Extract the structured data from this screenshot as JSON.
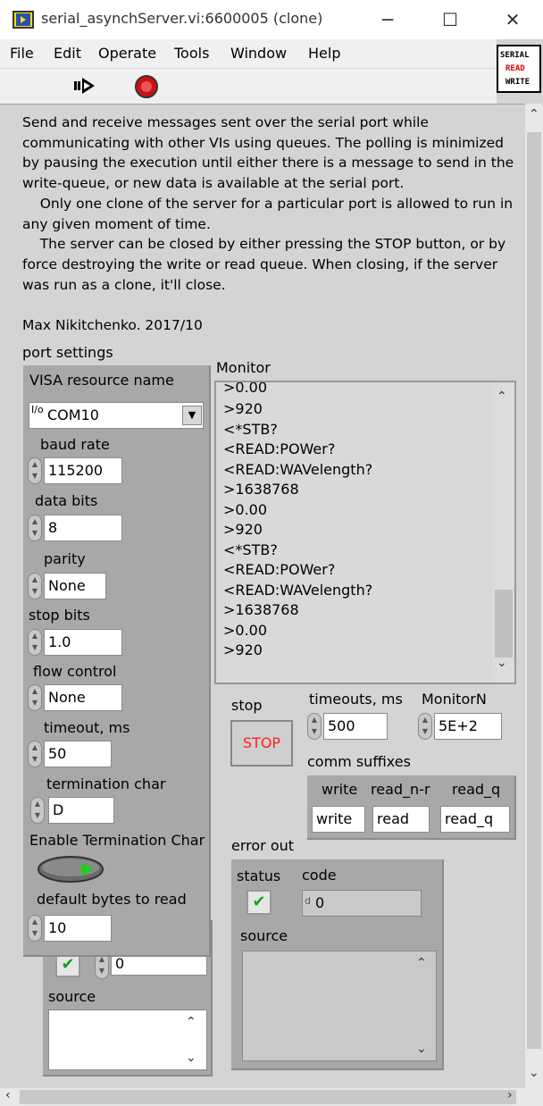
{
  "window": {
    "title": "serial_asynchServer.vi:6600005 (clone)",
    "minimize": "─",
    "maximize": "☐",
    "close": "✕"
  },
  "menu": [
    "File",
    "Edit",
    "Operate",
    "Tools",
    "Window",
    "Help"
  ],
  "logo": {
    "line1": "SERIAL",
    "line2": "READ",
    "line3": "WRITE"
  },
  "description": "Send and receive messages sent over the serial port while\ncommunicating with other VIs using queues. The polling is minimized\nby pausing the execution until either there is a message to send in the\nwrite-queue, or new data is available at the serial port.\n    Only one clone of the server for a particular port is allowed to run in\nany given moment of time.\n    The server can be closed by either pressing the STOP button, or by\nforce destroying the write or read queue. When closing, if the server\nwas run as a clone, it'll close.\n\nMax Nikitchenko. 2017/10",
  "port_settings": {
    "label": "port settings",
    "visa_label": "VISA resource name",
    "visa_value": "COM10",
    "visa_prefix": "I/o",
    "baud_label": "baud rate",
    "baud_value": "115200",
    "data_bits_label": "data bits",
    "data_bits_value": "8",
    "parity_label": "parity",
    "parity_value": "None",
    "stop_bits_label": "stop bits",
    "stop_bits_value": "1.0",
    "flow_label": "flow control",
    "flow_value": "None",
    "timeout_label": "timeout, ms",
    "timeout_value": "50",
    "term_char_label": "termination char",
    "term_char_value": "D",
    "enable_term_label": "Enable Termination Char",
    "bytes_label": "default bytes to read",
    "bytes_value": "10"
  },
  "hidden_error": {
    "code_value": "0",
    "source_label": "source"
  },
  "monitor": {
    "label": "Monitor",
    "partial_top": ">0.00",
    "lines": [
      ">920",
      "<*STB?",
      "<READ:POWer?",
      "<READ:WAVelength?",
      ">1638768",
      ">0.00",
      ">920",
      "<*STB?",
      "<READ:POWer?",
      "<READ:WAVelength?",
      ">1638768",
      ">0.00",
      ">920"
    ]
  },
  "stop": {
    "label": "stop",
    "button": "STOP"
  },
  "timeouts": {
    "label": "timeouts, ms",
    "value": "500"
  },
  "monitorN": {
    "label": "MonitorN",
    "value": "5E+2"
  },
  "comm_suffixes": {
    "label": "comm suffixes",
    "cols": [
      {
        "header": "write",
        "value": "write"
      },
      {
        "header": "read_n-r",
        "value": "read"
      },
      {
        "header": "read_q",
        "value": "read_q"
      }
    ]
  },
  "error_out": {
    "label": "error out",
    "status_label": "status",
    "code_label": "code",
    "code_value": "0",
    "code_prefix": "d",
    "source_label": "source"
  },
  "colors": {
    "stop_text": "#ff2020",
    "led_green": "#22cc22",
    "check_green": "#19a219"
  }
}
